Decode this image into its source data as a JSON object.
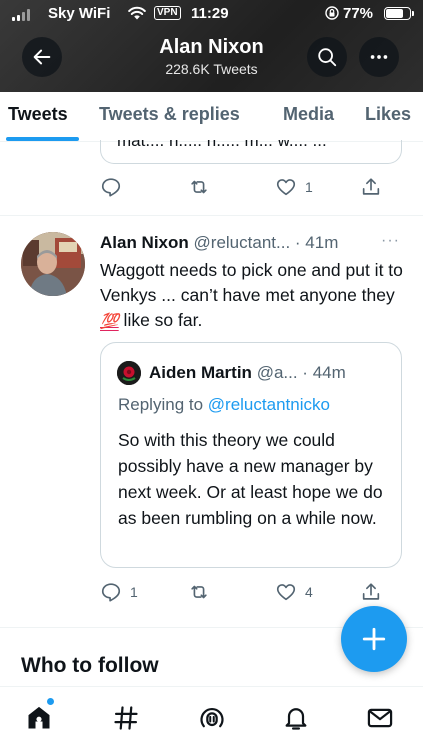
{
  "status_bar": {
    "carrier": "Sky WiFi",
    "vpn": "VPN",
    "time": "11:29",
    "battery_percent": "77%",
    "battery_level": 0.77
  },
  "header": {
    "title": "Alan Nixon",
    "subtitle": "228.6K Tweets"
  },
  "tabs": [
    {
      "label": "Tweets",
      "active": true
    },
    {
      "label": "Tweets & replies",
      "active": false
    },
    {
      "label": "Media",
      "active": false
    },
    {
      "label": "Likes",
      "active": false
    }
  ],
  "previous_tweet": {
    "quote_fragment": "mat.... h..... h..... m... w.... ...",
    "like_count": "1"
  },
  "tweet": {
    "name": "Alan Nixon",
    "handle": "@reluctant...",
    "separator": " · ",
    "time": "41m",
    "more": "···",
    "text_before_emoji": "Waggott needs to pick one and put it to Venkys ... can’t have met anyone they ",
    "emoji": "💯",
    "text_after_emoji": " like so far.",
    "quote": {
      "name": "Aiden Martin",
      "handle": "@a...",
      "separator": " · ",
      "time": "44m",
      "replying_to_label": "Replying to ",
      "replying_to_handle": "@reluctantnicko",
      "text": "So with this theory we could possibly have a new manager by next week. Or at least hope we do as been rumbling on a while now."
    },
    "reply_count": "1",
    "retweet_count": "",
    "like_count": "4"
  },
  "who_to_follow": {
    "title": "Who to follow"
  },
  "colors": {
    "accent": "#1d9bf0",
    "text_primary": "#0f1419",
    "text_secondary": "#536471",
    "border": "#cfd9de",
    "header_bg": "#2b2b2b"
  },
  "icons": {
    "back": "arrow-left-icon",
    "search": "search-icon",
    "more": "more-icon",
    "reply": "reply-icon",
    "retweet": "retweet-icon",
    "like": "heart-icon",
    "share": "share-icon",
    "compose": "compose-plus-icon",
    "nav": [
      "home-icon",
      "explore-icon",
      "spaces-icon",
      "notifications-icon",
      "messages-icon"
    ]
  }
}
